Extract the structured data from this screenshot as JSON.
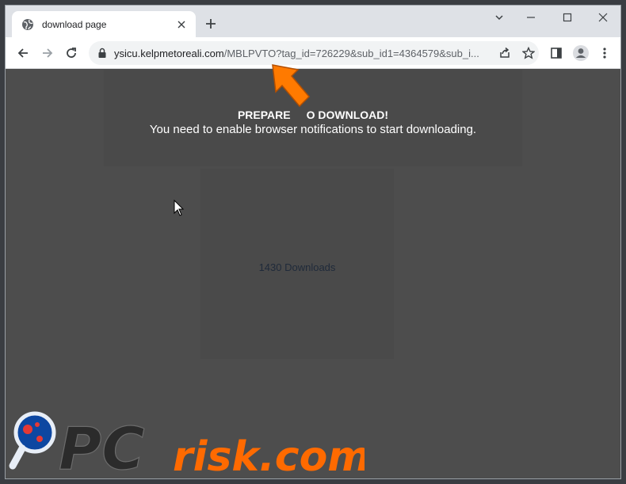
{
  "tab": {
    "title": "download page",
    "favicon": "globe-icon"
  },
  "window_controls": [
    "minimize-icon",
    "maximize-icon",
    "close-icon"
  ],
  "toolbar": {
    "url_host": "ysicu.kelpmetoreali.com",
    "url_rest": "/MBLPVTO?tag_id=726229&sub_id1=4364579&sub_i..."
  },
  "page": {
    "heading_left": "PREPARE",
    "heading_right": "O DOWNLOAD!",
    "subheading": "You need to enable browser notifications to start downloading.",
    "downloads": "1430 Downloads"
  },
  "watermark": {
    "text": "PCrisk.com",
    "colors": {
      "pc": "#2b2b2b",
      "risk": "#ff6a00",
      "magnifier": "#1e88e5"
    }
  },
  "colors": {
    "accent_arrow": "#ff7a00",
    "page_bg": "#4d4d4d",
    "tabstrip_bg": "#dee1e6"
  }
}
